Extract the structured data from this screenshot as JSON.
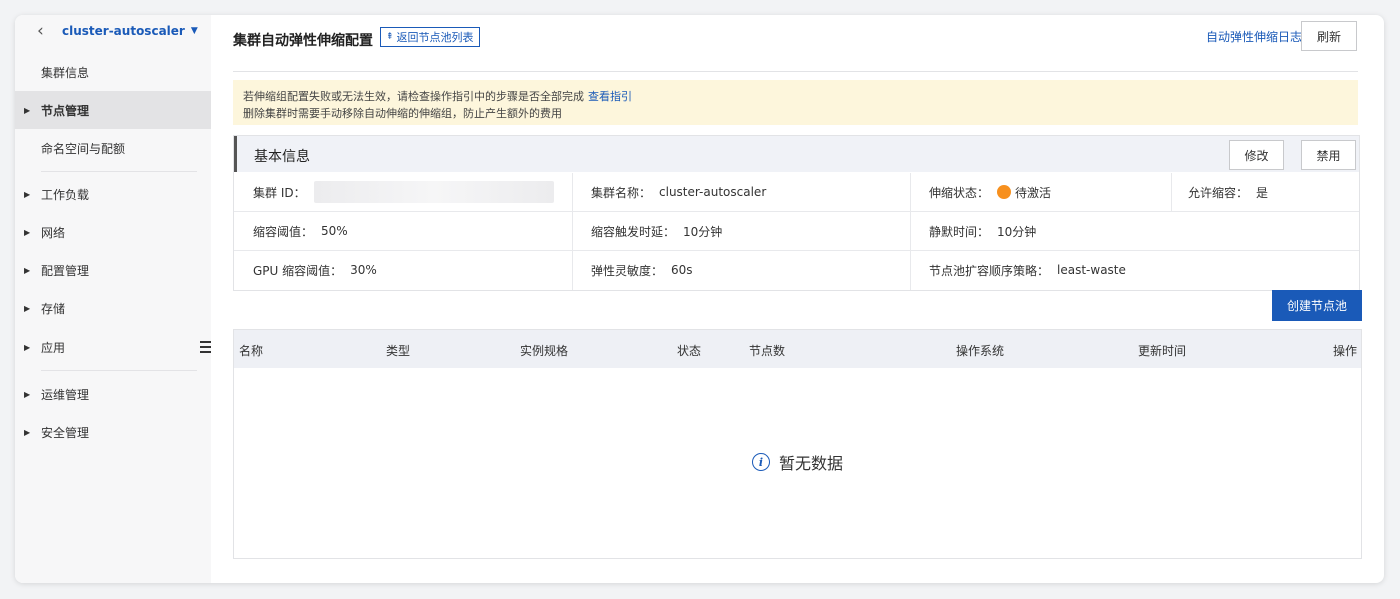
{
  "sidebar": {
    "cluster_name": "cluster-autoscaler",
    "items": [
      {
        "label": "集群信息"
      },
      {
        "label": "节点管理"
      },
      {
        "label": "命名空间与配额"
      },
      {
        "label": "工作负载"
      },
      {
        "label": "网络"
      },
      {
        "label": "配置管理"
      },
      {
        "label": "存储"
      },
      {
        "label": "应用"
      },
      {
        "label": "运维管理"
      },
      {
        "label": "安全管理"
      }
    ],
    "active_item": "节点管理"
  },
  "header": {
    "title": "集群自动弹性伸缩配置",
    "back_label": "返回节点池列表",
    "log_link": "自动弹性伸缩日志",
    "refresh_label": "刷新"
  },
  "notice": {
    "line1": "若伸缩组配置失败或无法生效，请检查操作指引中的步骤是否全部完成",
    "line1_link": "查看指引",
    "line2": "删除集群时需要手动移除自动伸缩的伸缩组，防止产生额外的费用"
  },
  "basic_info": {
    "title": "基本信息",
    "edit_label": "修改",
    "disable_label": "禁用",
    "fields": {
      "cluster_id_label": "集群 ID：",
      "cluster_name_label": "集群名称：",
      "cluster_name_value": "cluster-autoscaler",
      "scale_status_label": "伸缩状态：",
      "scale_status_value": "待激活",
      "allow_scale_in_label": "允许缩容：",
      "allow_scale_in_value": "是",
      "scale_in_threshold_label": "缩容阈值：",
      "scale_in_threshold_value": "50%",
      "scale_in_delay_label": "缩容触发时延：",
      "scale_in_delay_value": "10分钟",
      "cooldown_label": "静默时间：",
      "cooldown_value": "10分钟",
      "gpu_threshold_label": "GPU 缩容阈值：",
      "gpu_threshold_value": "30%",
      "sensitivity_label": "弹性灵敏度：",
      "sensitivity_value": "60s",
      "expander_label": "节点池扩容顺序策略：",
      "expander_value": "least-waste"
    },
    "status_color": "#f7901e"
  },
  "create_pool_label": "创建节点池",
  "table": {
    "columns": [
      "名称",
      "类型",
      "实例规格",
      "状态",
      "节点数",
      "操作系统",
      "更新时间",
      "操作"
    ],
    "empty_text": "暂无数据"
  },
  "colors": {
    "accent": "#1a5ab8",
    "notice_bg": "#fdf6dc"
  }
}
